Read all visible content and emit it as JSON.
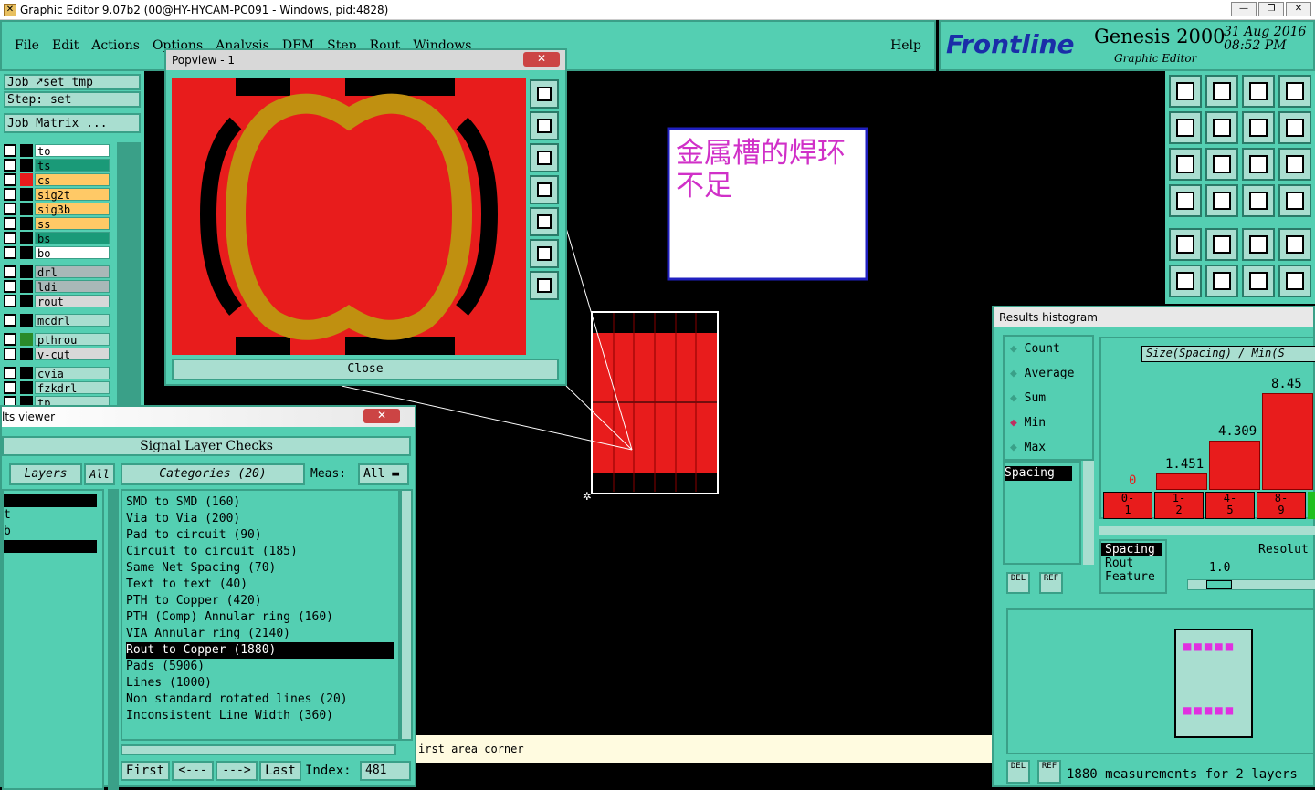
{
  "window": {
    "title": "Graphic Editor 9.07b2 (00@HY-HYCAM-PC091 - Windows, pid:4828)"
  },
  "menu": [
    "File",
    "Edit",
    "Actions",
    "Options",
    "Analysis",
    "DFM",
    "Step",
    "Rout",
    "Windows"
  ],
  "help": "Help",
  "brand": {
    "logo": "Frontline",
    "product": "Genesis 2000",
    "sub": "Graphic Editor",
    "date": "31 Aug 2016",
    "time": "08:52 PM"
  },
  "left": {
    "job_label": "Job",
    "job": "set_tmp",
    "step": "Step: set",
    "matrix": "Job Matrix ..."
  },
  "layers": [
    {
      "name": "to",
      "color": "#ffffff",
      "sw": "#000000"
    },
    {
      "name": "ts",
      "color": "#1a9a78",
      "sw": "#000000"
    },
    {
      "name": "cs",
      "color": "#ffc966",
      "sw": "#e81c1c"
    },
    {
      "name": "sig2t",
      "color": "#ffc966",
      "sw": "#000000"
    },
    {
      "name": "sig3b",
      "color": "#ffc966",
      "sw": "#000000"
    },
    {
      "name": "ss",
      "color": "#ffc966",
      "sw": "#000000"
    },
    {
      "name": "bs",
      "color": "#1a9a78",
      "sw": "#000000"
    },
    {
      "name": "bo",
      "color": "#ffffff",
      "sw": "#000000"
    },
    {
      "name": "drl",
      "color": "#a9b8b8",
      "sw": "#000000"
    },
    {
      "name": "ldi",
      "color": "#a9b8b8",
      "sw": "#000000"
    },
    {
      "name": "rout",
      "color": "#d8d8d8",
      "sw": "#000000"
    },
    {
      "name": "mcdrl",
      "color": "#a9ded0",
      "sw": "#000000"
    },
    {
      "name": "pthrou",
      "color": "#a9ded0",
      "sw": "#2a8a2a"
    },
    {
      "name": "v-cut",
      "color": "#d8d8d8",
      "sw": "#000000"
    },
    {
      "name": "cvia",
      "color": "#a9ded0",
      "sw": "#000000"
    },
    {
      "name": "fzkdrl",
      "color": "#a9ded0",
      "sw": "#000000"
    },
    {
      "name": "tp",
      "color": "#a9ded0",
      "sw": "#000000"
    }
  ],
  "popview": {
    "title": "Popview - 1",
    "close": "Close"
  },
  "annotation": {
    "text": "金属槽的焊环不足"
  },
  "results_viewer": {
    "title": "lts viewer",
    "header": "Signal Layer Checks",
    "layers_btn": "Layers",
    "all_btn": "All",
    "categories_btn": "Categories (20)",
    "meas_label": "Meas:",
    "meas_value": "All",
    "left_items": [
      "t",
      "b"
    ],
    "categories": [
      "SMD to SMD (160)",
      "Via to Via (200)",
      "Pad to circuit (90)",
      "Circuit to circuit (185)",
      "Same Net Spacing (70)",
      "Text to text (40)",
      "PTH to Copper (420)",
      "PTH (Comp) Annular ring (160)",
      "VIA Annular ring (2140)",
      "Rout to Copper (1880)",
      "Pads (5906)",
      "Lines (1000)",
      "Non standard rotated lines (20)",
      "Inconsistent Line Width (360)"
    ],
    "selected_index": 9,
    "nav": {
      "first": "First",
      "prev": "<---",
      "next": "--->",
      "last": "Last",
      "index_label": "Index:",
      "index_value": "481"
    }
  },
  "status": {
    "text": "irst area corner"
  },
  "histogram": {
    "title": "Results histogram",
    "modes": [
      "Count",
      "Average",
      "Sum",
      "Min",
      "Max"
    ],
    "selected_mode": "Min",
    "list1": [
      "Spacing"
    ],
    "chart_title": "Size(Spacing) / Min(S",
    "bars": [
      {
        "label": "0",
        "value": 0
      },
      {
        "label": "1.451",
        "value": 1.451
      },
      {
        "label": "4.309",
        "value": 4.309
      },
      {
        "label": "8.45",
        "value": 8.45
      }
    ],
    "ranges": [
      [
        "0-",
        "1"
      ],
      [
        "1-",
        "2"
      ],
      [
        "4-",
        "5"
      ],
      [
        "8-",
        "9"
      ]
    ],
    "list2": [
      "Spacing",
      "Rout",
      "Feature"
    ],
    "resolution_label": "Resolut",
    "resolution_value": "1.0",
    "del": "DEL",
    "ref": "REF",
    "footer": "1880 measurements for 2 layers"
  }
}
